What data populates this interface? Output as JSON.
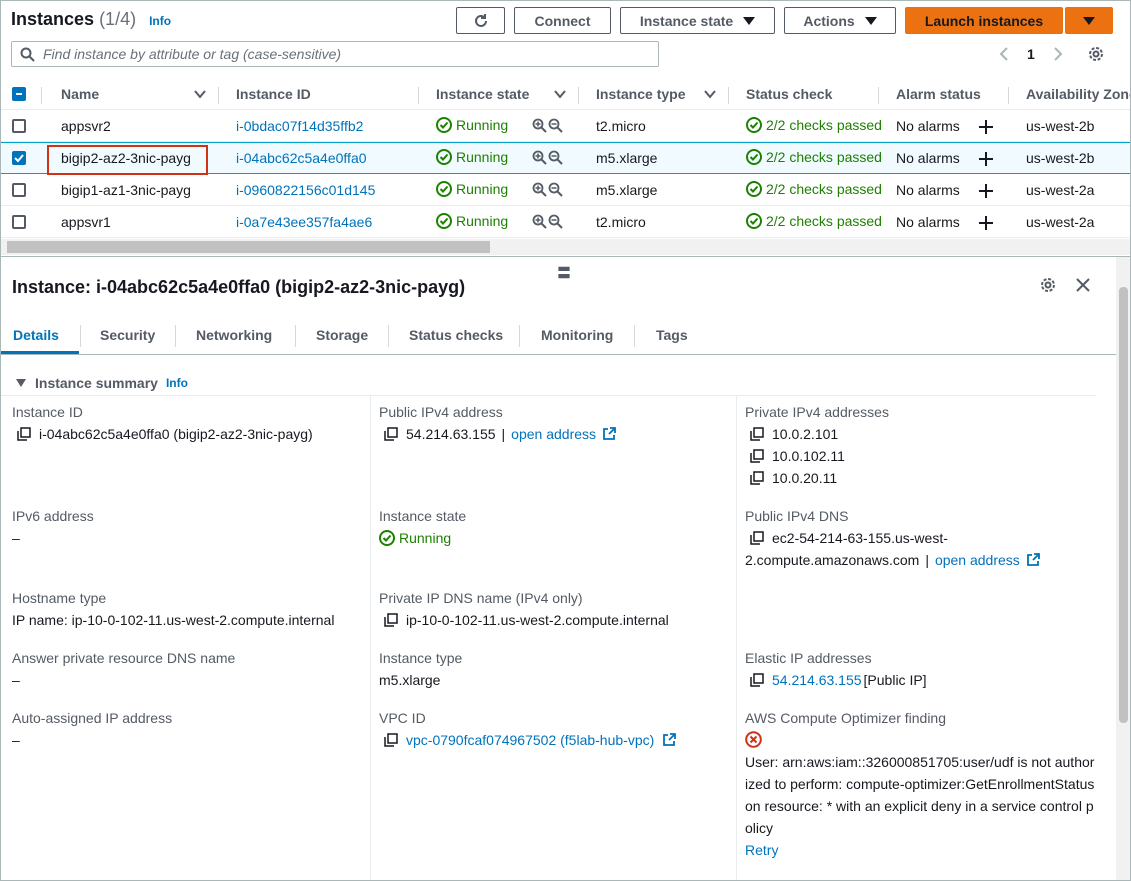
{
  "header": {
    "title": "Instances",
    "count": "(1/4)",
    "info": "Info",
    "connect": "Connect",
    "instance_state": "Instance state",
    "actions": "Actions",
    "launch": "Launch instances"
  },
  "search": {
    "placeholder": "Find instance by attribute or tag (case-sensitive)"
  },
  "pager": {
    "page": "1"
  },
  "columns": [
    "Name",
    "Instance ID",
    "Instance state",
    "Instance type",
    "Status check",
    "Alarm status",
    "Availability Zone"
  ],
  "rows": [
    {
      "name": "appsvr2",
      "id": "i-0bdac07f14d35ffb2",
      "state": "Running",
      "type": "t2.micro",
      "status": "2/2 checks passed",
      "alarm": "No alarms",
      "az": "us-west-2b",
      "selected": false
    },
    {
      "name": "bigip2-az2-3nic-payg",
      "id": "i-04abc62c5a4e0ffa0",
      "state": "Running",
      "type": "m5.xlarge",
      "status": "2/2 checks passed",
      "alarm": "No alarms",
      "az": "us-west-2b",
      "selected": true
    },
    {
      "name": "bigip1-az1-3nic-payg",
      "id": "i-0960822156c01d145",
      "state": "Running",
      "type": "m5.xlarge",
      "status": "2/2 checks passed",
      "alarm": "No alarms",
      "az": "us-west-2a",
      "selected": false
    },
    {
      "name": "appsvr1",
      "id": "i-0a7e43ee357fa4ae6",
      "state": "Running",
      "type": "t2.micro",
      "status": "2/2 checks passed",
      "alarm": "No alarms",
      "az": "us-west-2a",
      "selected": false
    }
  ],
  "detail": {
    "title": "Instance: i-04abc62c5a4e0ffa0 (bigip2-az2-3nic-payg)",
    "tabs": [
      "Details",
      "Security",
      "Networking",
      "Storage",
      "Status checks",
      "Monitoring",
      "Tags"
    ],
    "summary": "Instance summary",
    "info": "Info",
    "instance_id_label": "Instance ID",
    "instance_id_value": "i-04abc62c5a4e0ffa0 (bigip2-az2-3nic-payg)",
    "public_ipv4_label": "Public IPv4 address",
    "public_ipv4_value": "54.214.63.155",
    "public_ipv4_sep": "|",
    "open_address": "open address",
    "private_ipv4_label": "Private IPv4 addresses",
    "private_ipv4_values": [
      "10.0.2.101",
      "10.0.102.11",
      "10.0.20.11"
    ],
    "ipv6_label": "IPv6 address",
    "ipv6_value": "–",
    "instance_state_label": "Instance state",
    "instance_state_value": "Running",
    "public_dns_label": "Public IPv4 DNS",
    "public_dns_line1": "ec2-54-214-63-155.us-west-",
    "public_dns_line2": "2.compute.amazonaws.com",
    "public_dns_sep": "|",
    "hostname_type_label": "Hostname type",
    "hostname_type_value": "IP name: ip-10-0-102-11.us-west-2.compute.internal",
    "private_dns_label": "Private IP DNS name (IPv4 only)",
    "private_dns_value": "ip-10-0-102-11.us-west-2.compute.internal",
    "answer_dns_label": "Answer private resource DNS name",
    "answer_dns_value": "–",
    "instance_type_label": "Instance type",
    "instance_type_value": "m5.xlarge",
    "elastic_ip_label": "Elastic IP addresses",
    "elastic_ip_value": "54.214.63.155",
    "elastic_ip_suffix": "[Public IP]",
    "auto_ip_label": "Auto-assigned IP address",
    "auto_ip_value": "–",
    "vpc_label": "VPC ID",
    "vpc_value": "vpc-0790fcaf074967502 (f5lab-hub-vpc)",
    "optimizer_label": "AWS Compute Optimizer finding",
    "optimizer_error": "User: arn:aws:iam::326000851705:user/udf is not authorized to perform: compute-optimizer:GetEnrollmentStatus on resource: * with an explicit deny in a service control policy",
    "retry": "Retry"
  },
  "colors": {
    "link": "#0073bb",
    "success": "#1d8102",
    "error": "#d13212",
    "primary": "#ec7211"
  }
}
